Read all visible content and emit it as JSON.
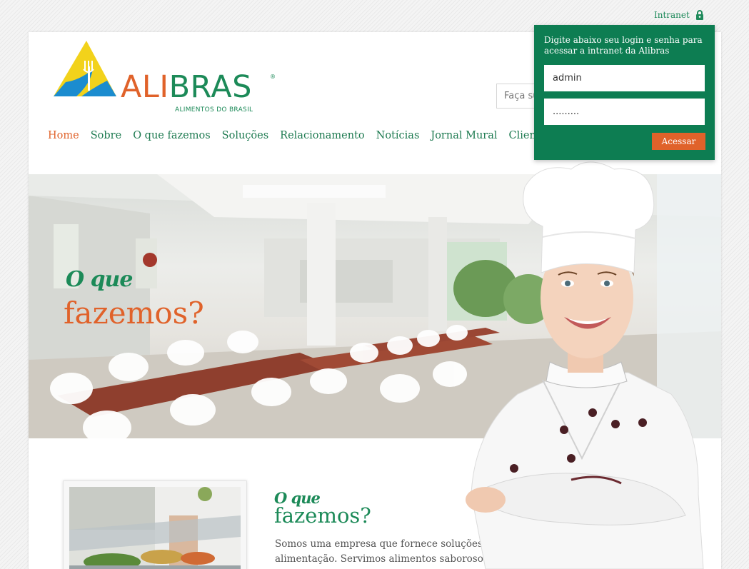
{
  "topbar": {
    "intranet_label": "Intranet"
  },
  "brand": {
    "name_part1": "ALI",
    "name_part2": "BRAS",
    "registered": "®",
    "tagline": "ALIMENTOS DO BRASIL"
  },
  "search": {
    "placeholder": "Faça sua busca"
  },
  "nav": {
    "items": [
      {
        "label": "Home",
        "active": true
      },
      {
        "label": "Sobre"
      },
      {
        "label": "O que fazemos"
      },
      {
        "label": "Soluções"
      },
      {
        "label": "Relacionamento"
      },
      {
        "label": "Notícias"
      },
      {
        "label": "Jornal Mural"
      },
      {
        "label": "Clientes"
      }
    ]
  },
  "hero": {
    "title_small": "O que",
    "title_big": "fazemos?"
  },
  "content": {
    "title_small": "O que",
    "title_big": "fazemos?",
    "text": "Somos uma empresa que fornece soluções em alimentação. Servimos alimentos saborosos em"
  },
  "login": {
    "message": "Digite abaixo seu login e senha para acessar a intranet da Alibras",
    "username_value": "admin",
    "password_value": ".........",
    "submit_label": "Acessar"
  },
  "colors": {
    "brand_green": "#0d7d52",
    "brand_orange": "#e0622a",
    "logo_yellow": "#f2d21b",
    "logo_blue": "#1b8ccf"
  }
}
